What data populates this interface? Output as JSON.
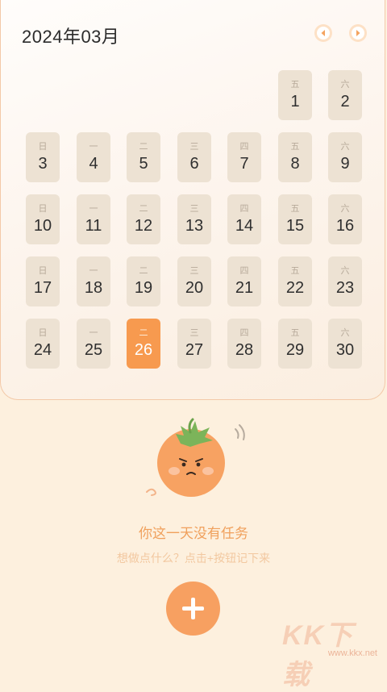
{
  "header": {
    "month_title": "2024年03月"
  },
  "calendar": {
    "days": [
      {
        "weekday": "五",
        "day": "1"
      },
      {
        "weekday": "六",
        "day": "2"
      },
      {
        "weekday": "日",
        "day": "3"
      },
      {
        "weekday": "一",
        "day": "4"
      },
      {
        "weekday": "二",
        "day": "5"
      },
      {
        "weekday": "三",
        "day": "6"
      },
      {
        "weekday": "四",
        "day": "7"
      },
      {
        "weekday": "五",
        "day": "8"
      },
      {
        "weekday": "六",
        "day": "9"
      },
      {
        "weekday": "日",
        "day": "10"
      },
      {
        "weekday": "一",
        "day": "11"
      },
      {
        "weekday": "二",
        "day": "12"
      },
      {
        "weekday": "三",
        "day": "13"
      },
      {
        "weekday": "四",
        "day": "14"
      },
      {
        "weekday": "五",
        "day": "15"
      },
      {
        "weekday": "六",
        "day": "16"
      },
      {
        "weekday": "日",
        "day": "17"
      },
      {
        "weekday": "一",
        "day": "18"
      },
      {
        "weekday": "二",
        "day": "19"
      },
      {
        "weekday": "三",
        "day": "20"
      },
      {
        "weekday": "四",
        "day": "21"
      },
      {
        "weekday": "五",
        "day": "22"
      },
      {
        "weekday": "六",
        "day": "23"
      },
      {
        "weekday": "日",
        "day": "24"
      },
      {
        "weekday": "一",
        "day": "25"
      },
      {
        "weekday": "二",
        "day": "26",
        "selected": true
      },
      {
        "weekday": "三",
        "day": "27"
      },
      {
        "weekday": "四",
        "day": "28"
      },
      {
        "weekday": "五",
        "day": "29"
      },
      {
        "weekday": "六",
        "day": "30"
      }
    ]
  },
  "empty_state": {
    "title": "你这一天没有任务",
    "hint": "想做点什么？点击+按钮记下来"
  },
  "watermark": {
    "logo": "KK下载",
    "url": "www.kkx.net"
  },
  "colors": {
    "accent": "#f79a4f",
    "day_bg": "#ede2d3",
    "background": "#fdf0de"
  },
  "icons": {
    "prev": "chevron-left-icon",
    "next": "chevron-right-icon",
    "add": "plus-icon",
    "mascot": "tomato-mascot-icon"
  }
}
